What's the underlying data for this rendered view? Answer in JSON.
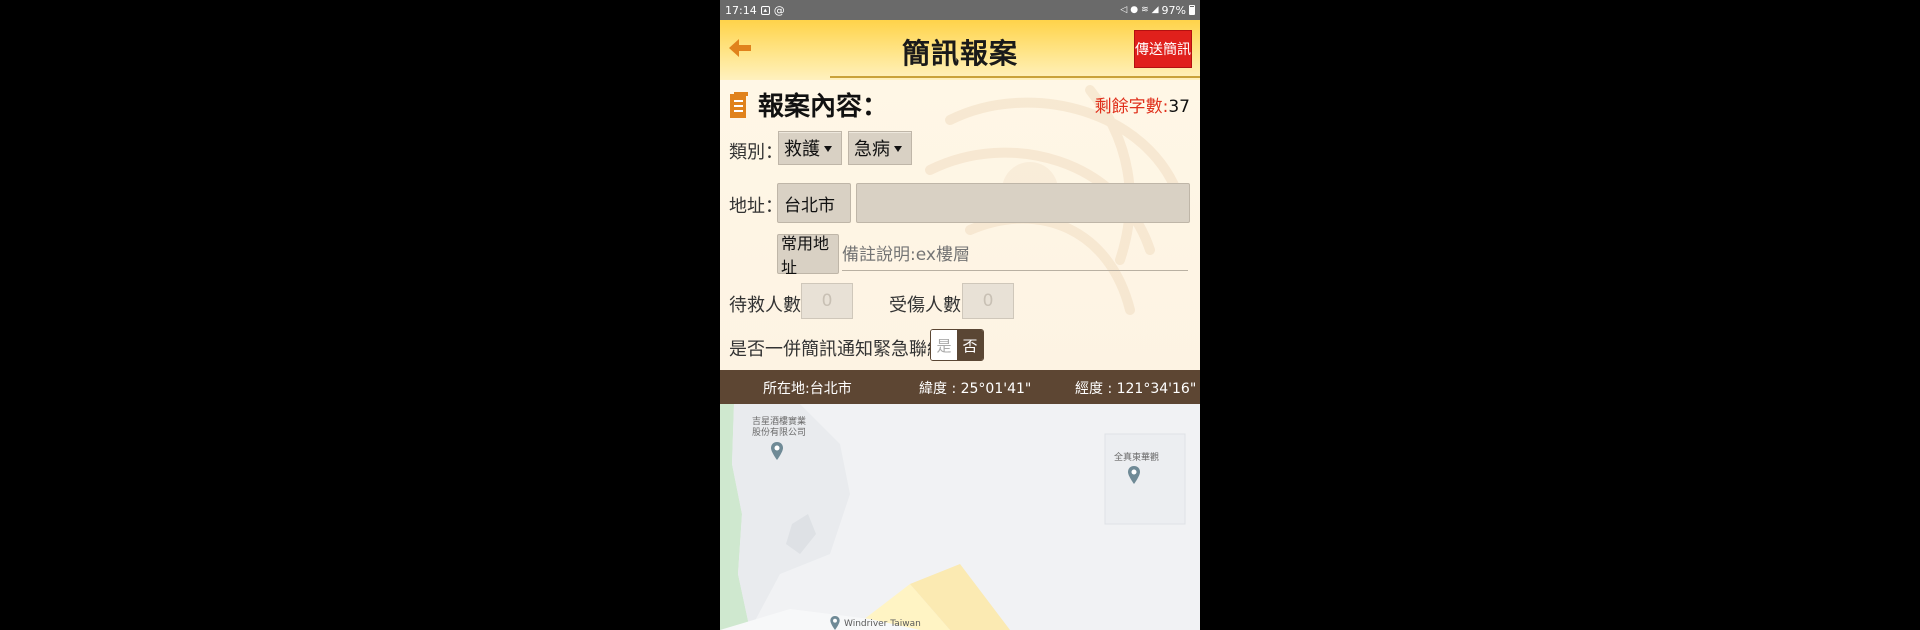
{
  "status_bar": {
    "time": "17:14",
    "battery": "97%",
    "left_icons": [
      "person-icon",
      "at-icon"
    ],
    "right_icons": [
      "mute-icon",
      "location-icon",
      "wifi-icon",
      "signal-icon",
      "battery-icon"
    ]
  },
  "header": {
    "title": "簡訊報案",
    "send_label": "傳送簡訊",
    "back_icon": "back-arrow-icon"
  },
  "form": {
    "section_title": "報案內容：",
    "remaining_label": "剩餘字數:",
    "remaining_count": "37",
    "category_label": "類別：",
    "category_value": "救護",
    "subcategory_value": "急病",
    "address_label": "地址：",
    "city_value": "台北市",
    "address_value": "",
    "common_address_label": "常用地址",
    "note_placeholder": "備註說明:ex樓層",
    "rescue_count_label": "待救人數：",
    "rescue_count_placeholder": "0",
    "injured_count_label": "受傷人數：",
    "injured_count_placeholder": "0",
    "notify_label": "是否一併簡訊通知緊急聯絡人：",
    "notify_yes": "是",
    "notify_no": "否",
    "notify_selected": "否"
  },
  "location": {
    "place": "所在地:台北市",
    "latitude": "緯度 : 25°01'41\"",
    "longitude": "經度 : 121°34'16\""
  },
  "map": {
    "poi_1": "吉星酒樓實業股份有限公司",
    "poi_1_line1": "吉星酒樓實業",
    "poi_1_line2": "股份有限公司",
    "poi_2": "全真東華觀",
    "poi_3": "Windriver Taiwan"
  },
  "colors": {
    "header_yellow": "#ffd34a",
    "send_red": "#e0201c",
    "location_bar_brown": "#5d4633",
    "remaining_red": "#e0301c",
    "back_orange": "#e0821c"
  }
}
